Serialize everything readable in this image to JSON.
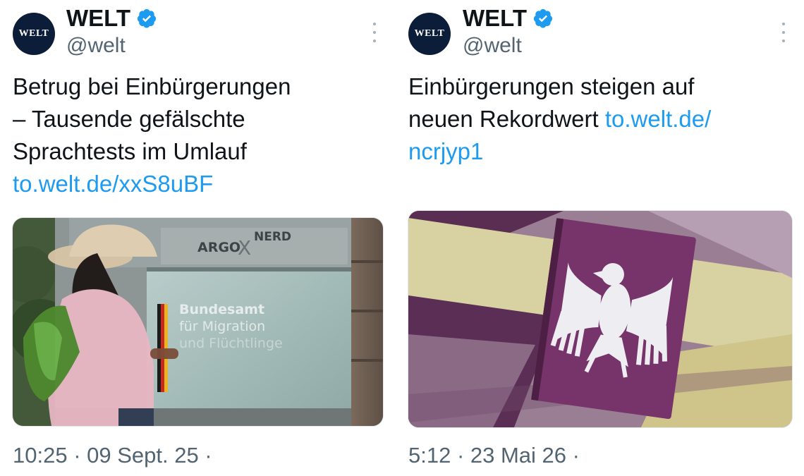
{
  "tweets": [
    {
      "author": {
        "name": "WELT",
        "handle": "@welt",
        "avatar_text": "WELT",
        "verified": true
      },
      "text_lines": [
        "Betrug bei Einbürgerungen",
        "– Tausende gefälschte",
        "Sprachtests im Umlauf"
      ],
      "link": "to.welt.de/xxS8uBF",
      "photo": {
        "sign_brand_left": "ARGO",
        "sign_brand_x": "X",
        "sign_brand_right": "NERD",
        "window_lines": [
          "Bundesamt",
          "für Migration",
          "und Flüchtlinge"
        ]
      },
      "timestamp": "10:25 · 09 Sept. 25 ·"
    },
    {
      "author": {
        "name": "WELT",
        "handle": "@welt",
        "avatar_text": "WELT",
        "verified": true
      },
      "text_lines": [
        "Einbürgerungen steigen auf",
        "neuen Rekordwert "
      ],
      "link_part1": "to.welt.de/",
      "link_part2": "ncrjyp1",
      "photo": {
        "subject": "german-passport-eagle"
      },
      "timestamp": "5:12 · 23 Mai 26 ·"
    }
  ],
  "colors": {
    "link": "#1d9bf0",
    "verified": "#1d9bf0",
    "avatar_bg": "#0b1d38",
    "muted_text": "#536471"
  }
}
